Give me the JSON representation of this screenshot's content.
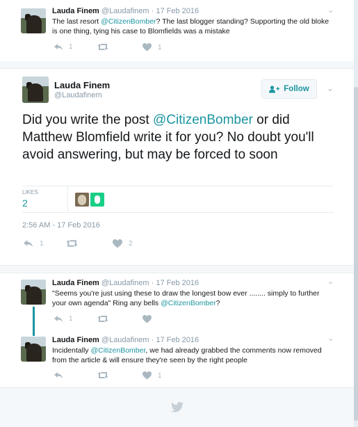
{
  "top_tweet": {
    "name": "Lauda Finem",
    "handle": "@Laudafinem",
    "date": "· 17 Feb 2016",
    "text_pre": "The last resort ",
    "mention": "@CitizenBomber",
    "text_post": "? The last blogger standing? Supporting the old bloke is one thing, tying his case to Blomfields was a mistake",
    "reply_count": "1",
    "like_count": "1"
  },
  "main_tweet": {
    "name": "Lauda Finem",
    "handle": "@Laudafinem",
    "follow_label": "Follow",
    "text_pre": "Did you write the post ",
    "mention": "@CitizenBomber",
    "text_post": " or did Matthew Blomfield write it for you? No doubt you'll avoid answering, but may be forced to soon",
    "likes_label": "LIKES",
    "likes_count": "2",
    "timestamp": "2:56 AM - 17 Feb 2016",
    "reply_count": "1",
    "like_count": "2"
  },
  "replies": [
    {
      "name": "Lauda Finem",
      "handle": "@Laudafinem",
      "date": "· 17 Feb 2016",
      "text_pre": "\"Seems you're just using these to draw the longest bow ever ........ simply to further your own agenda\" Ring any bells ",
      "mention": "@CitizenBomber",
      "text_post": "?",
      "reply_count": "1",
      "like_count": ""
    },
    {
      "name": "Lauda Finem",
      "handle": "@Laudafinem",
      "date": "· 17 Feb 2016",
      "text_pre": "Incidentally ",
      "mention": "@CitizenBomber",
      "text_post": ", we had already grabbed the comments now removed from the article & will ensure they're seen by the right people",
      "reply_count": "",
      "like_count": "1"
    }
  ],
  "colors": {
    "accent": "#1b95a0",
    "muted": "#aab8c2",
    "heart_badge": "#19cf86"
  },
  "icons": [
    "reply-icon",
    "retweet-icon",
    "heart-icon",
    "chevron-down-icon",
    "follow-person-plus-icon",
    "twitter-bird-icon"
  ]
}
